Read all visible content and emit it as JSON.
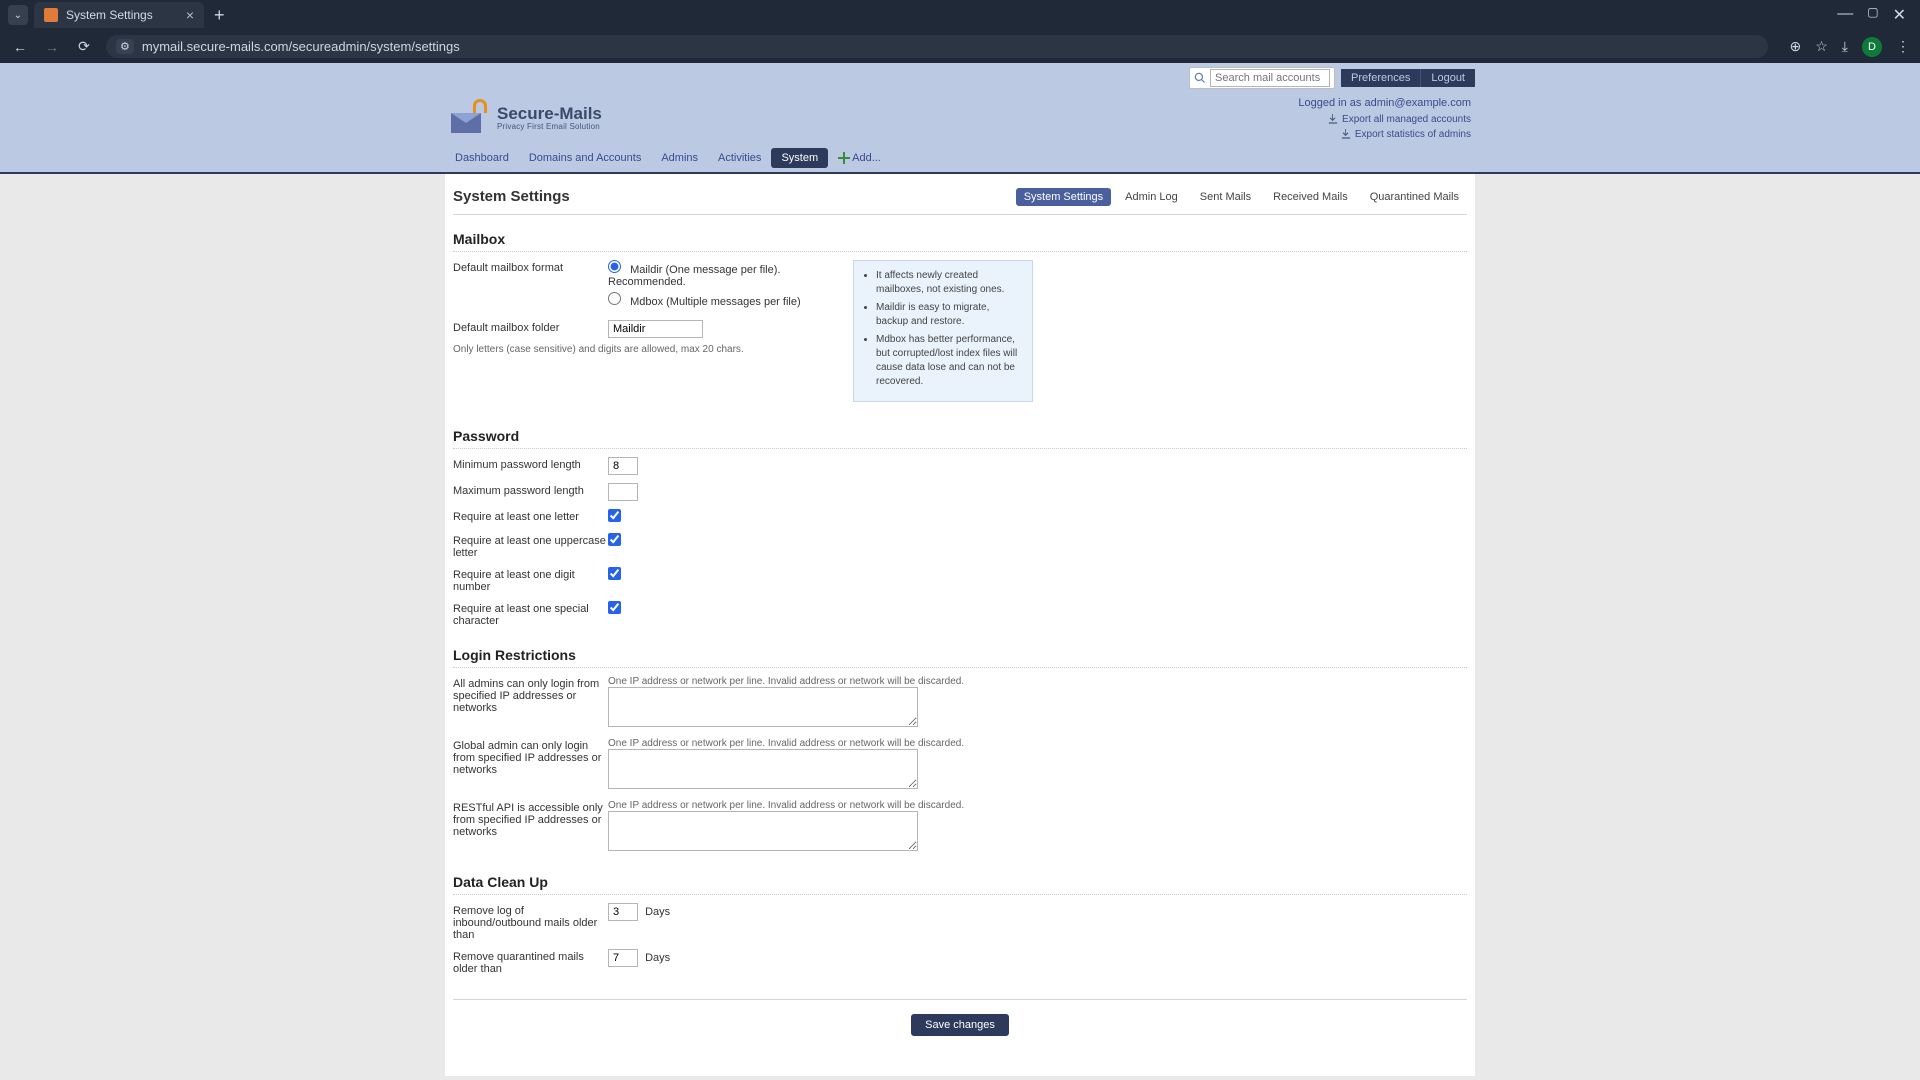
{
  "browser": {
    "tab_title": "System Settings",
    "url": "mymail.secure-mails.com/secureadmin/system/settings",
    "avatar_initial": "D"
  },
  "top": {
    "search_placeholder": "Search mail accounts",
    "preferences": "Preferences",
    "logout": "Logout"
  },
  "logo": {
    "title": "Secure-Mails",
    "subtitle": "Privacy First Email Solution"
  },
  "login_info": {
    "logged_in_prefix": "Logged in as ",
    "user": "admin@example.com",
    "export_accounts": "Export all managed accounts",
    "export_stats": "Export statistics of admins"
  },
  "nav": {
    "dashboard": "Dashboard",
    "domains": "Domains and Accounts",
    "admins": "Admins",
    "activities": "Activities",
    "system": "System",
    "add": "Add..."
  },
  "page_title": "System Settings",
  "subnav": {
    "system_settings": "System Settings",
    "admin_log": "Admin Log",
    "sent_mails": "Sent Mails",
    "received_mails": "Received Mails",
    "quarantined_mails": "Quarantined Mails"
  },
  "sections": {
    "mailbox": "Mailbox",
    "password": "Password",
    "login_restrictions": "Login Restrictions",
    "data_cleanup": "Data Clean Up"
  },
  "mailbox": {
    "format_label": "Default mailbox format",
    "maildir_label": "Maildir (One message per file). Recommended.",
    "mdbox_label": "Mdbox (Multiple messages per file)",
    "folder_label": "Default mailbox folder",
    "folder_value": "Maildir",
    "folder_hint": "Only letters (case sensitive) and digits are allowed, max 20 chars.",
    "info1": "It affects newly created mailboxes, not existing ones.",
    "info2": "Maildir is easy to migrate, backup and restore.",
    "info3": "Mdbox has better performance, but corrupted/lost index files will cause data lose and can not be recovered."
  },
  "password": {
    "min_len_label": "Minimum password length",
    "min_len_value": "8",
    "max_len_label": "Maximum password length",
    "max_len_value": "",
    "req_letter": "Require at least one letter",
    "req_upper": "Require at least one uppercase letter",
    "req_digit": "Require at least one digit number",
    "req_special": "Require at least one special character"
  },
  "login_restrictions": {
    "all_admins_label": "All admins can only login from specified IP addresses or networks",
    "global_admin_label": "Global admin can only login from specified IP addresses or networks",
    "restful_label": "RESTful API is accessible only from specified IP addresses or networks",
    "ip_hint": "One IP address or network per line. Invalid address or network will be discarded."
  },
  "data_cleanup": {
    "remove_log_label": "Remove log of inbound/outbound mails older than",
    "remove_log_value": "3",
    "remove_quarantine_label": "Remove quarantined mails older than",
    "remove_quarantine_value": "7",
    "days_unit": "Days"
  },
  "save_button": "Save changes"
}
